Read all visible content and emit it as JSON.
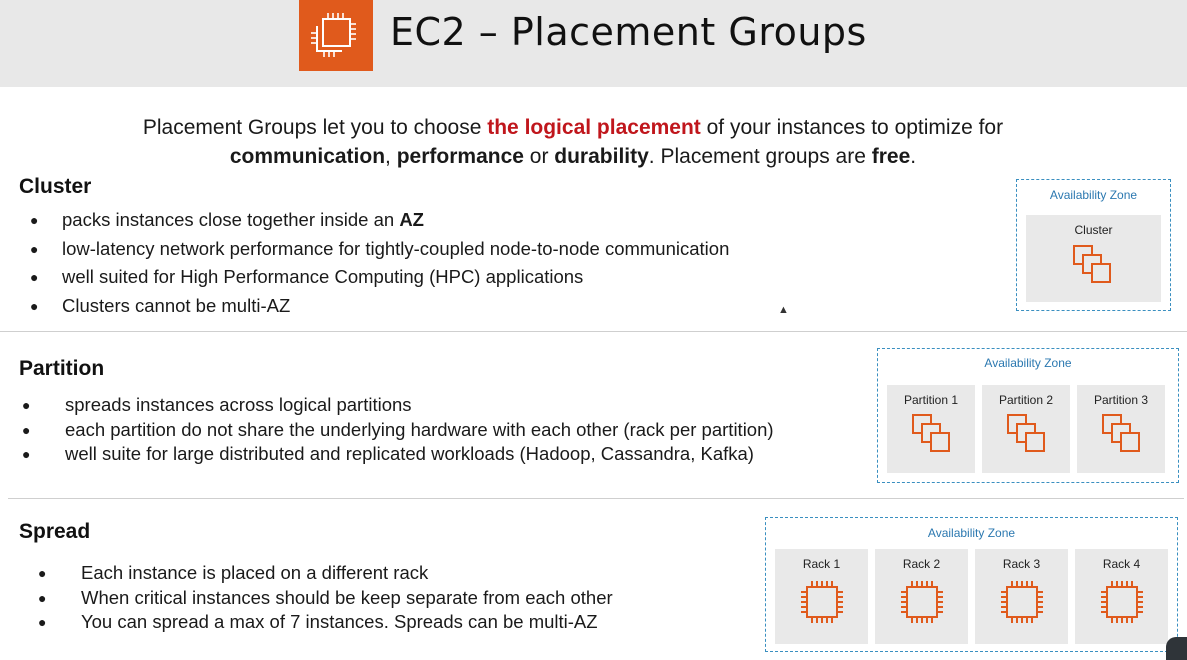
{
  "header": {
    "title": "EC2 – Placement Groups",
    "logo_icon": "ec2-chip-icon",
    "logo_color": "#e05a1c"
  },
  "intro": {
    "p1": "Placement Groups let you to choose ",
    "highlight": "the logical placement",
    "p2": " of your instances to optimize for",
    "w1": "communication",
    "s1": ", ",
    "w2": "performance",
    "s2": " or ",
    "w3": "durability",
    "s3": ". Placement groups are ",
    "w4": "free",
    "s4": "."
  },
  "cluster": {
    "title": "Cluster",
    "bullet1_pre": "packs instances close together inside an ",
    "bullet1_bold": "AZ",
    "bullet2": "low-latency network performance for tightly-coupled node-to-node communication",
    "bullet3": "well suited for High Performance Computing (HPC) applications",
    "bullet4": "Clusters cannot be multi-AZ",
    "az_label": "Availability Zone",
    "box_label": "Cluster"
  },
  "partition": {
    "title": "Partition",
    "bullet1": "spreads instances across logical partitions",
    "bullet2": "each partition do not share the underlying hardware with each other (rack per partition)",
    "bullet3": "well suite for large distributed and replicated workloads (Hadoop, Cassandra, Kafka)",
    "az_label": "Availability Zone",
    "boxes": [
      "Partition 1",
      "Partition 2",
      "Partition 3"
    ]
  },
  "spread": {
    "title": "Spread",
    "bullet1": "Each instance is placed on a different rack",
    "bullet2": "When critical instances should be keep separate from each other",
    "bullet3": "You can spread a max of 7 instances. Spreads can be multi-AZ",
    "az_label": "Availability Zone",
    "racks": [
      "Rack 1",
      "Rack 2",
      "Rack 3",
      "Rack 4"
    ]
  },
  "colors": {
    "accent_red": "#c0161c",
    "aws_orange": "#e05a1c",
    "az_border": "#3a8fc0"
  },
  "icons": {
    "instances": "instances-icon",
    "chip": "chip-icon",
    "bullet": "•"
  }
}
